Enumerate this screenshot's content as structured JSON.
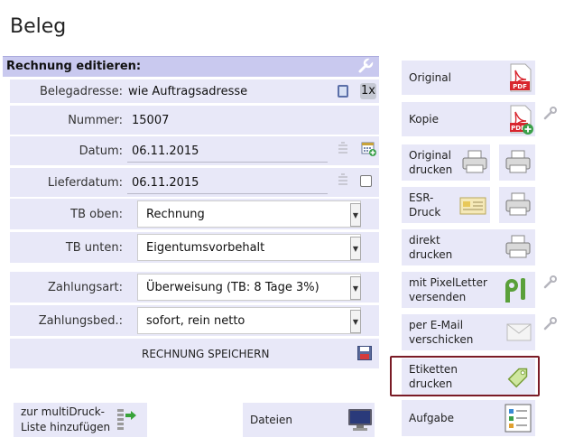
{
  "page": {
    "title": "Beleg"
  },
  "form": {
    "header": "Rechnung editieren:",
    "fields": {
      "belegadresse": {
        "label": "Belegadresse:",
        "value": "wie Auftragsadresse",
        "badge": "1x"
      },
      "nummer": {
        "label": "Nummer:",
        "value": "15007"
      },
      "datum": {
        "label": "Datum:",
        "value": "06.11.2015"
      },
      "lieferdatum": {
        "label": "Lieferdatum:",
        "value": "06.11.2015"
      },
      "tb_oben": {
        "label": "TB oben:",
        "value": "Rechnung"
      },
      "tb_unten": {
        "label": "TB unten:",
        "value": "Eigentumsvorbehalt"
      },
      "zahlungsart": {
        "label": "Zahlungsart:",
        "value": "Überweisung (TB: 8 Tage 3%)"
      },
      "zahlungsbed": {
        "label": "Zahlungsbed.:",
        "value": "sofort, rein netto"
      }
    },
    "save_label": "RECHNUNG SPEICHERN"
  },
  "bottom": {
    "multidruck_line1": "zur multiDruck-",
    "multidruck_line2": "Liste hinzufügen",
    "dateien": "Dateien"
  },
  "actions": {
    "original": "Original",
    "kopie": "Kopie",
    "original_drucken_1": "Original",
    "original_drucken_2": "drucken",
    "esr_1": "ESR-",
    "esr_2": "Druck",
    "direkt_1": "direkt",
    "direkt_2": "drucken",
    "pixelletter_1": "mit PixelLetter",
    "pixelletter_2": "versenden",
    "email_1": "per E-Mail",
    "email_2": "verschicken",
    "etiketten_1": "Etiketten",
    "etiketten_2": "drucken",
    "aufgabe": "Aufgabe"
  },
  "icons": {
    "pdf_label": "PDF",
    "pdf_label_2": "PDF"
  },
  "colors": {
    "header_bg": "#c9c9ef",
    "row_bg": "#e8e8f8",
    "highlight": "#7a1b26",
    "pdf_red": "#d8262e"
  }
}
